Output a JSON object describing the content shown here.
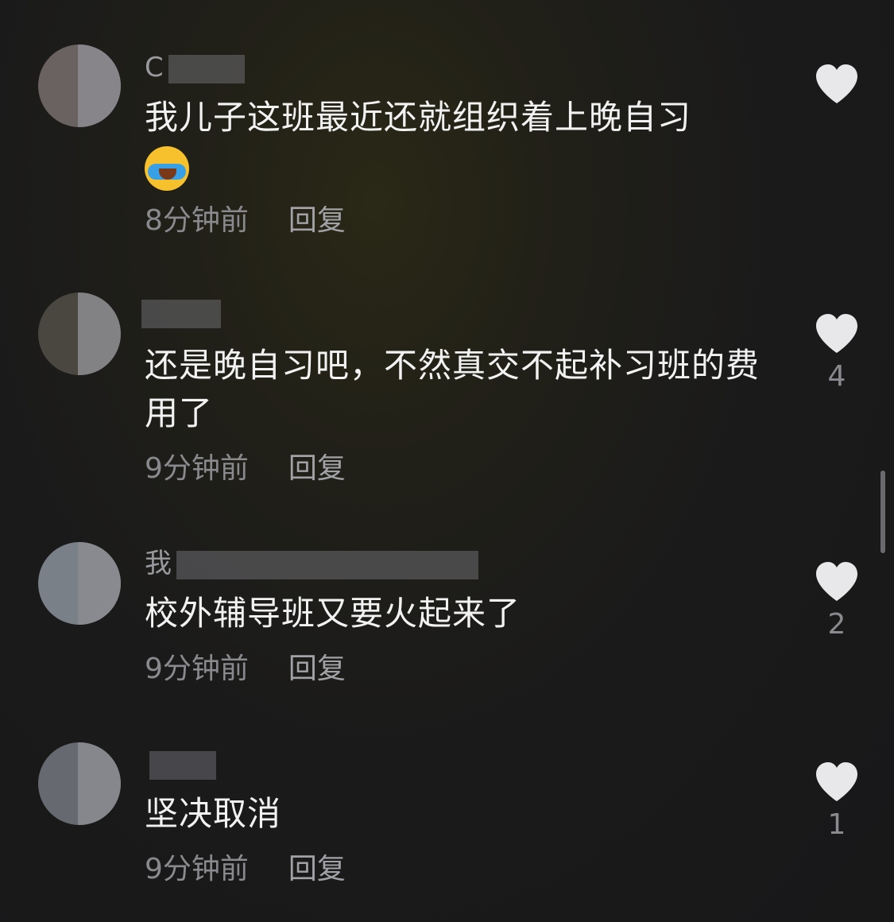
{
  "comments": [
    {
      "username": "C",
      "text": "我儿子这班最近还就组织着上晚自习",
      "has_emoji": true,
      "time": "8分钟前",
      "reply": "回复",
      "likes": ""
    },
    {
      "username": "",
      "text": "还是晚自习吧，不然真交不起补习班的费用了",
      "has_emoji": false,
      "time": "9分钟前",
      "reply": "回复",
      "likes": "4"
    },
    {
      "username": "我",
      "text": "校外辅导班又要火起来了",
      "has_emoji": false,
      "time": "9分钟前",
      "reply": "回复",
      "likes": "2"
    },
    {
      "username": "",
      "text": "坚决取消",
      "has_emoji": false,
      "time": "9分钟前",
      "reply": "回复",
      "likes": "1"
    }
  ],
  "icons": {
    "like": "heart-icon",
    "emoji": "face-with-tears-of-joy-icon"
  },
  "colors": {
    "heart": "#e8e8ea",
    "text": "#f2f2f2",
    "meta": "#8a8a8e"
  }
}
